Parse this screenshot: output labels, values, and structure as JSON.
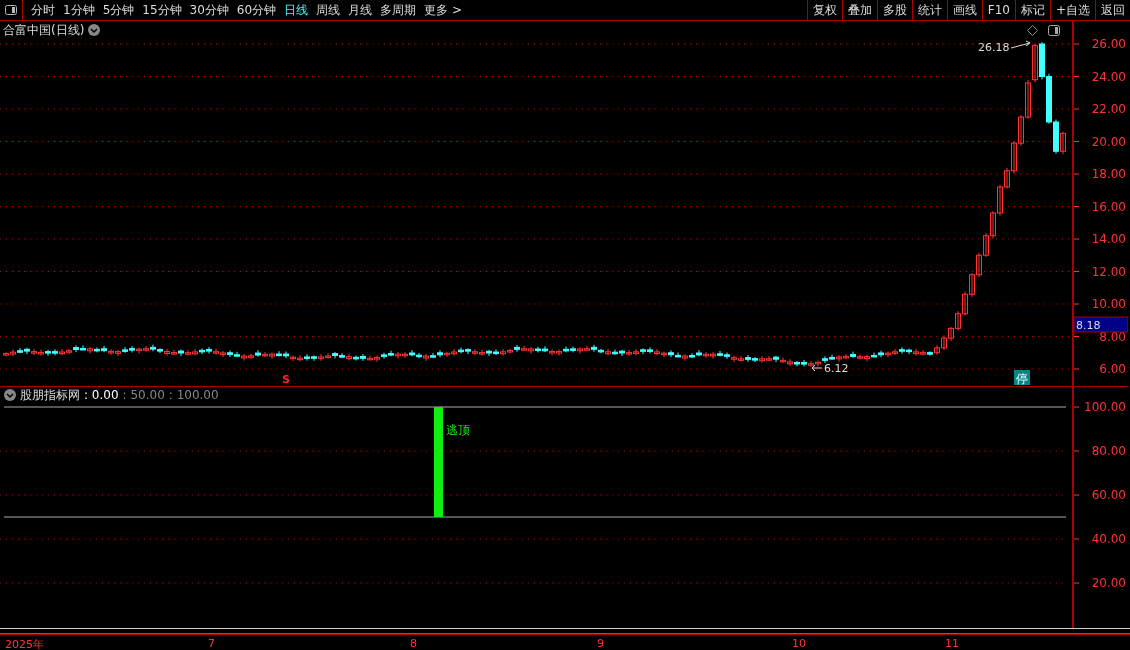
{
  "toolbar": {
    "periods": [
      {
        "label": "分时",
        "selected": false
      },
      {
        "label": "1分钟",
        "selected": false
      },
      {
        "label": "5分钟",
        "selected": false
      },
      {
        "label": "15分钟",
        "selected": false
      },
      {
        "label": "30分钟",
        "selected": false
      },
      {
        "label": "60分钟",
        "selected": false
      },
      {
        "label": "日线",
        "selected": true
      },
      {
        "label": "周线",
        "selected": false
      },
      {
        "label": "月线",
        "selected": false
      },
      {
        "label": "多周期",
        "selected": false
      },
      {
        "label": "更多 >",
        "selected": false
      }
    ],
    "actions": [
      "复权",
      "叠加",
      "多股",
      "统计",
      "画线",
      "F10",
      "标记",
      "+自选",
      "返回"
    ]
  },
  "main_chart": {
    "title": "合富中国(日线)",
    "y_ticks": [
      "26.00",
      "24.00",
      "22.00",
      "20.00",
      "18.00",
      "16.00",
      "14.00",
      "12.00",
      "10.00",
      "8.00",
      "6.00"
    ],
    "high_label": "26.18",
    "low_label": "6.12",
    "current_price": "8.18",
    "signal_marker": "S",
    "halt_badge": "停"
  },
  "indicator": {
    "name": "股朋指标网",
    "values": [
      {
        "text": ": 0.00",
        "kind": "current"
      },
      {
        "text": ": 50.00",
        "kind": "level"
      },
      {
        "text": ": 100.00",
        "kind": "level"
      }
    ],
    "signal_label": "逃顶",
    "y_ticks": [
      "100.00",
      "80.00",
      "60.00",
      "40.00",
      "20.00"
    ]
  },
  "date_axis": [
    "2025年",
    "7",
    "8",
    "9",
    "10",
    "11"
  ]
}
